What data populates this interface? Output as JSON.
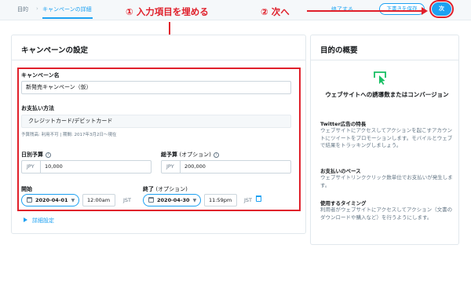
{
  "header": {
    "breadcrumb_1": "目的",
    "breadcrumb_sep": "›",
    "breadcrumb_2": "キャンペーンの詳細",
    "end_label": "終了する",
    "save_draft_label": "下書きを保存",
    "next_label": "次"
  },
  "annotations": {
    "step1": "① 入力項目を埋める",
    "step2": "② 次へ"
  },
  "campaign_settings": {
    "title": "キャンペーンの設定",
    "campaign_name_label": "キャンペーン名",
    "campaign_name_value": "新発売キャンペーン（仮）",
    "payment_label": "お支払い方法",
    "payment_value": "クレジットカード/デビットカード",
    "payment_note": "予算残高: 利用不可 | 期間: 2017年3月2日～現在",
    "daily_budget_label": "日別予算",
    "daily_budget_currency": "JPY",
    "daily_budget_value": "10,000",
    "total_budget_label": "総予算",
    "total_budget_optional": "(オプション)",
    "total_budget_currency": "JPY",
    "total_budget_value": "200,000",
    "start_label": "開始",
    "start_date": "2020-04-01",
    "start_time": "12:00am",
    "start_tz": "JST",
    "end_label": "終了",
    "end_optional": "(オプション)",
    "end_date": "2020-04-30",
    "end_time": "11:59pm",
    "end_tz": "JST",
    "advanced_link": "詳細設定"
  },
  "objective_summary": {
    "title": "目的の概要",
    "goal_title": "ウェブサイトへの誘導数またはコンバージョン",
    "features_title": "Twitter広告の特長",
    "features_body": "ウェブサイトにアクセスしてアクションを起こすアカウントにツイートをプロモーションします。モバイルとウェブで結果をトラッキングしましょう。",
    "payment_title": "お支払いのベース",
    "payment_body": "ウェブサイトリンククリック数単位でお支払いが発生します。",
    "timing_title": "使用するタイミング",
    "timing_body": "利用者がウェブサイトにアクセスしてアクション（文書のダウンロードや購入など）を行うようにします。"
  },
  "colors": {
    "accent": "#1da1f2",
    "annotation": "#e0202b",
    "goal_icon": "#17bf63"
  },
  "icons": [
    "info-icon",
    "calendar-icon",
    "chevron-down-icon",
    "trash-icon",
    "triangle-right-icon",
    "cursor-click-icon"
  ]
}
